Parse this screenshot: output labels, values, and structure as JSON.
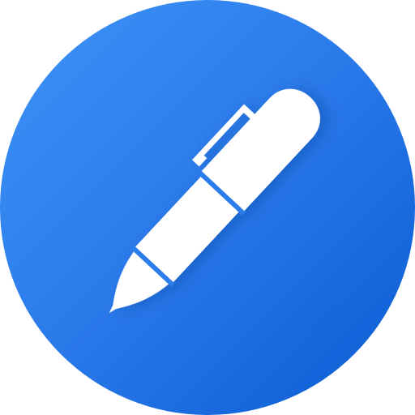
{
  "app_icon": {
    "icon_name": "pen-icon",
    "background_shape": "circle",
    "colors": {
      "gradient_light": "#3E93F7",
      "gradient_mid": "#2A79EA",
      "gradient_dark": "#0A5AD3",
      "glyph": "#FFFFFF",
      "glyph_stripe": "#2C7DEB"
    }
  }
}
